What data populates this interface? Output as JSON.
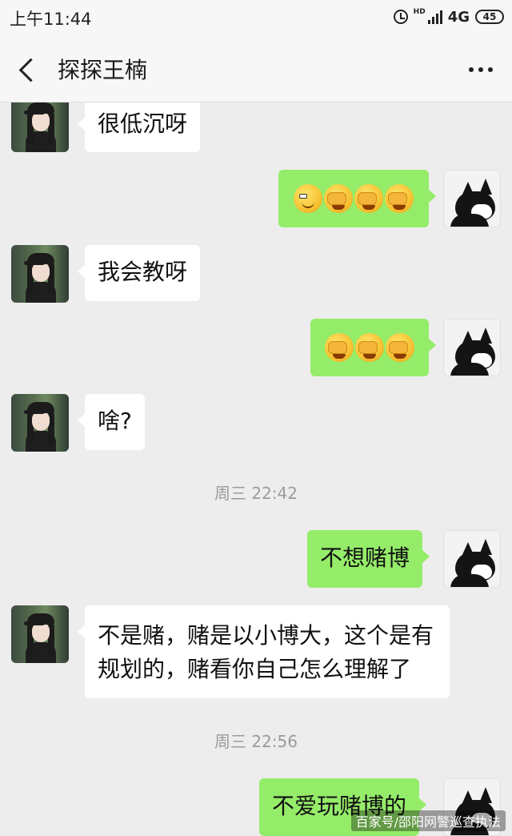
{
  "status_bar": {
    "time": "上午11:44",
    "hd": "HD",
    "network": "4G",
    "battery": "45"
  },
  "header": {
    "title": "探探王楠"
  },
  "messages": {
    "m1": "很低沉呀",
    "m3": "我会教呀",
    "m5": "啥?",
    "t1": "周三 22:42",
    "m6": "不想赌博",
    "m7": "不是赌，赌是以小博大，这个是有规划的，赌看你自己怎么理解了",
    "t2": "周三 22:56",
    "m8": "不爱玩赌博的"
  },
  "icons": {
    "back": "chevron-left-icon",
    "more": "more-horizontal-icon",
    "alarm": "alarm-clock-icon",
    "signal": "signal-bars-icon",
    "battery": "battery-icon",
    "emoji_smirk": "smirk-emoji-icon",
    "emoji_facepalm": "facepalm-emoji-icon"
  },
  "colors": {
    "chat_background": "#ededed",
    "sent_bubble": "#95ec69",
    "received_bubble": "#ffffff",
    "timestamp": "#9b9b9b"
  },
  "watermark": "百家号/邵阳网警巡查执法"
}
